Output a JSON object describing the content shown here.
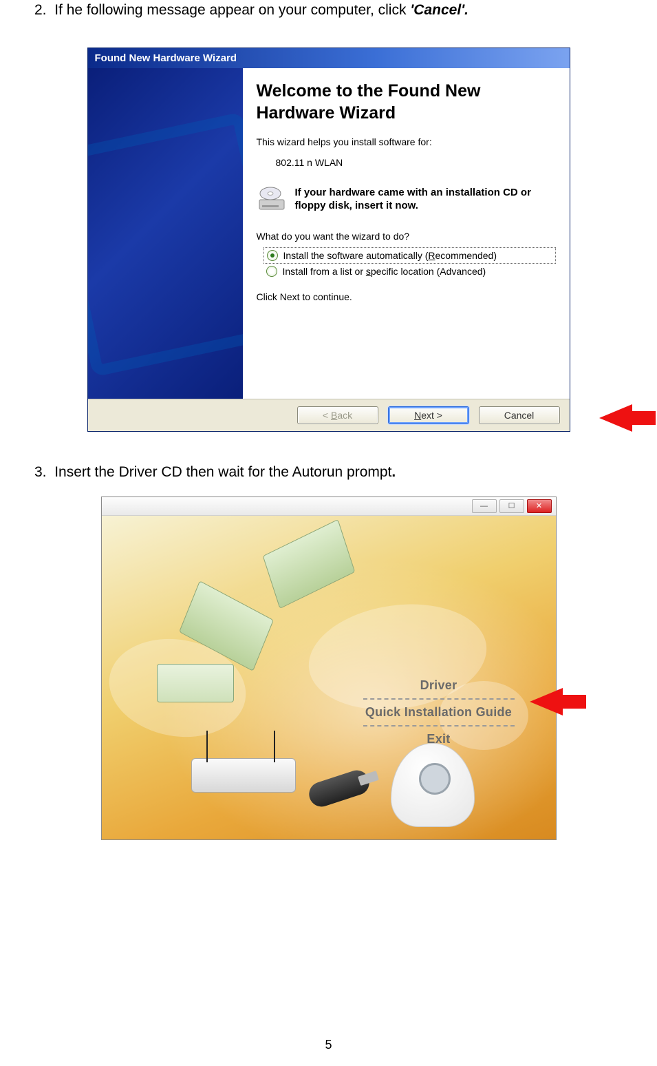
{
  "step2": {
    "num": "2.",
    "text_before": "If he following message appear on your computer, click ",
    "emph": "'Cancel'.",
    "text_after": ""
  },
  "wizard": {
    "title": "Found New Hardware Wizard",
    "heading": "Welcome to the Found New Hardware Wizard",
    "helps": "This wizard helps you install software for:",
    "device": "802.11 n WLAN",
    "cd_text": "If your hardware came with an installation CD or floppy disk, insert it now.",
    "prompt": "What do you want the wizard to do?",
    "option1_pre": "Install the software automatically (",
    "option1_u": "R",
    "option1_post": "ecommended)",
    "option2_pre": "Install from a list or ",
    "option2_u": "s",
    "option2_post": "pecific location (Advanced)",
    "continue": "Click Next to continue.",
    "buttons": {
      "back_pre": "< ",
      "back_u": "B",
      "back_post": "ack",
      "next_u": "N",
      "next_post": "ext >",
      "cancel": "Cancel"
    }
  },
  "step3": {
    "num": "3.",
    "text": "Insert the Driver CD then wait for the Autorun prompt",
    "period": "."
  },
  "autorun": {
    "menu": {
      "driver": "Driver",
      "guide": "Quick Installation Guide",
      "exit": "Exit"
    }
  },
  "page_number": "5"
}
